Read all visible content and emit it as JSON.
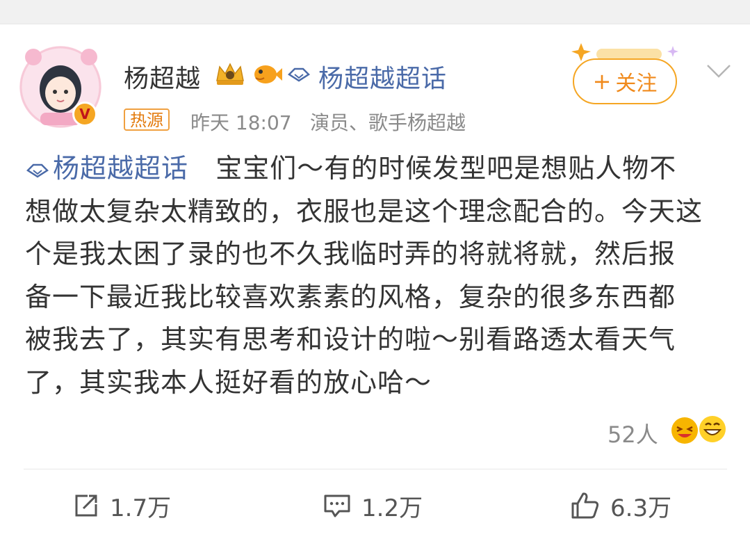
{
  "post": {
    "username": "杨超越",
    "topic_label": "杨超越超话",
    "follow_label": "关注",
    "follow_plus": "+",
    "hot_tag": "热源",
    "time": "昨天 18:07",
    "description": "演员、歌手杨超越",
    "body_line_1": "宝宝们～有的时候发型吧是想贴人物不",
    "body_line_2": "想做太复杂太精致的，衣服也是这个理念配合的。今天这",
    "body_line_3": "个是我太困了录的也不久我临时弄的将就将就，然后报",
    "body_line_4": "备一下最近我比较喜欢素素的风格，复杂的很多东西都",
    "body_line_5": "被我去了，其实有思考和设计的啦～别看路透太看天气",
    "body_line_6": "了，其实我本人挺好看的放心哈～",
    "reaction_count": "52人",
    "verified_mark": "V"
  },
  "actions": {
    "repost_count": "1.7万",
    "comment_count": "1.2万",
    "like_count": "6.3万"
  },
  "colors": {
    "topic_blue": "#4a6aa8",
    "accent_orange": "#f08a1c",
    "meta_gray": "#8a8a8a"
  },
  "icons": [
    "crown-badge-icon",
    "fish-badge-icon",
    "diamond-topic-icon",
    "chevron-down-icon",
    "repost-icon",
    "comment-icon",
    "like-icon"
  ]
}
